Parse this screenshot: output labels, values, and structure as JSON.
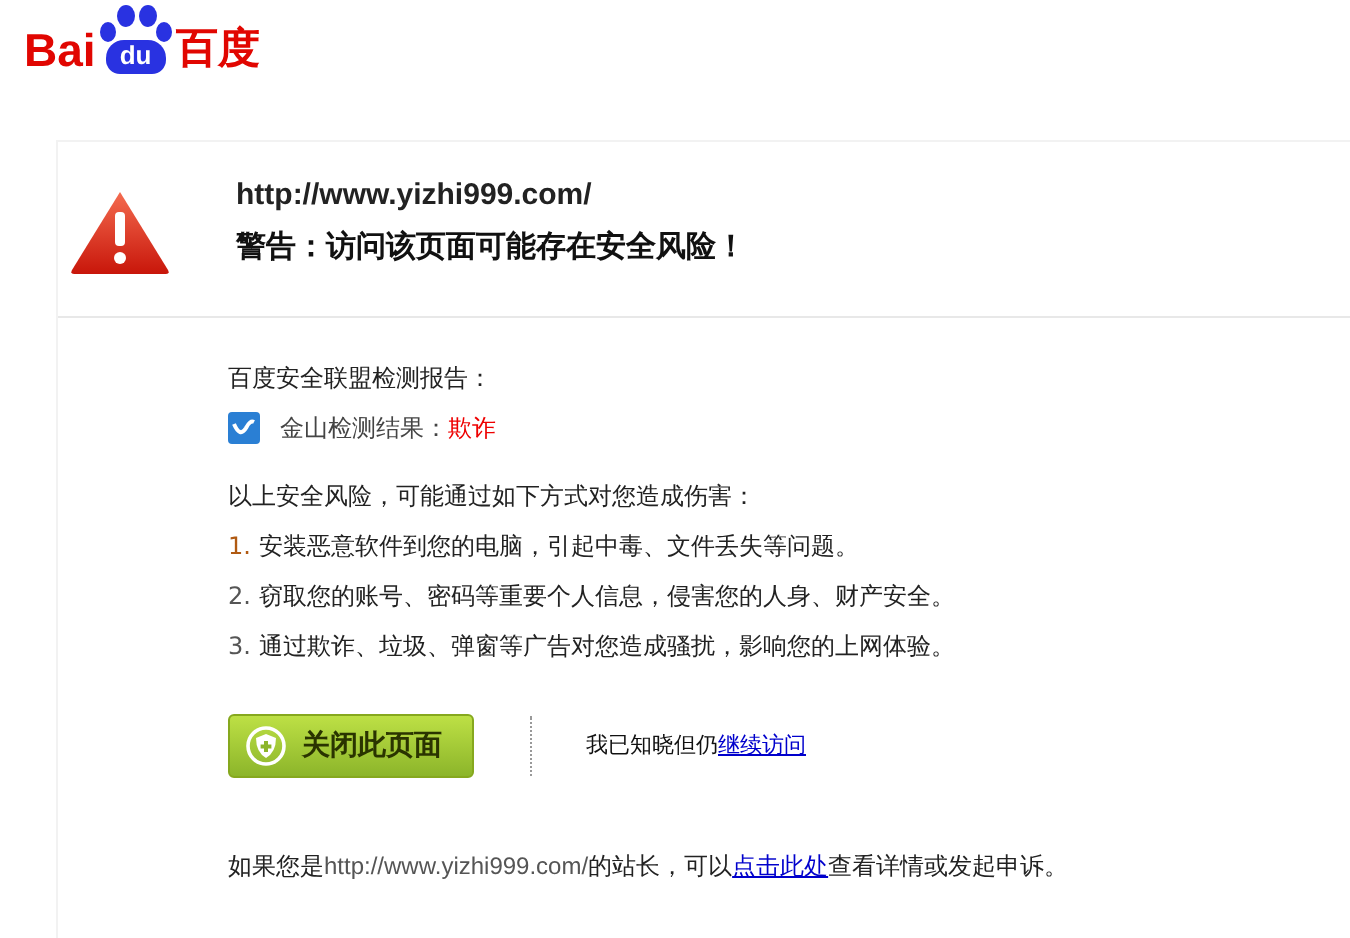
{
  "logo": {
    "latin": "Bai",
    "paw": "du",
    "chinese": "百度"
  },
  "warning": {
    "url": "http://www.yizhi999.com/",
    "title": "警告：访问该页面可能存在安全风险！"
  },
  "report": {
    "heading": "百度安全联盟检测报告：",
    "result_label": "金山检测结果：",
    "result_value": "欺诈"
  },
  "risks": {
    "intro": "以上安全风险，可能通过如下方式对您造成伤害：",
    "items": [
      {
        "number": "1.",
        "text": "安装恶意软件到您的电脑，引起中毒、文件丢失等问题。"
      },
      {
        "number": "2.",
        "text": "窃取您的账号、密码等重要个人信息，侵害您的人身、财产安全。"
      },
      {
        "number": "3.",
        "text": "通过欺诈、垃圾、弹窗等广告对您造成骚扰，影响您的上网体验。"
      }
    ]
  },
  "actions": {
    "close_button": "关闭此页面",
    "continue_text": "我已知晓但仍",
    "continue_link": "继续访问"
  },
  "footer": {
    "before": "如果您是",
    "url": "http://www.yizhi999.com/",
    "middle": "的站长，可以",
    "link": "点击此处",
    "after": "查看详情或发起申诉。"
  }
}
